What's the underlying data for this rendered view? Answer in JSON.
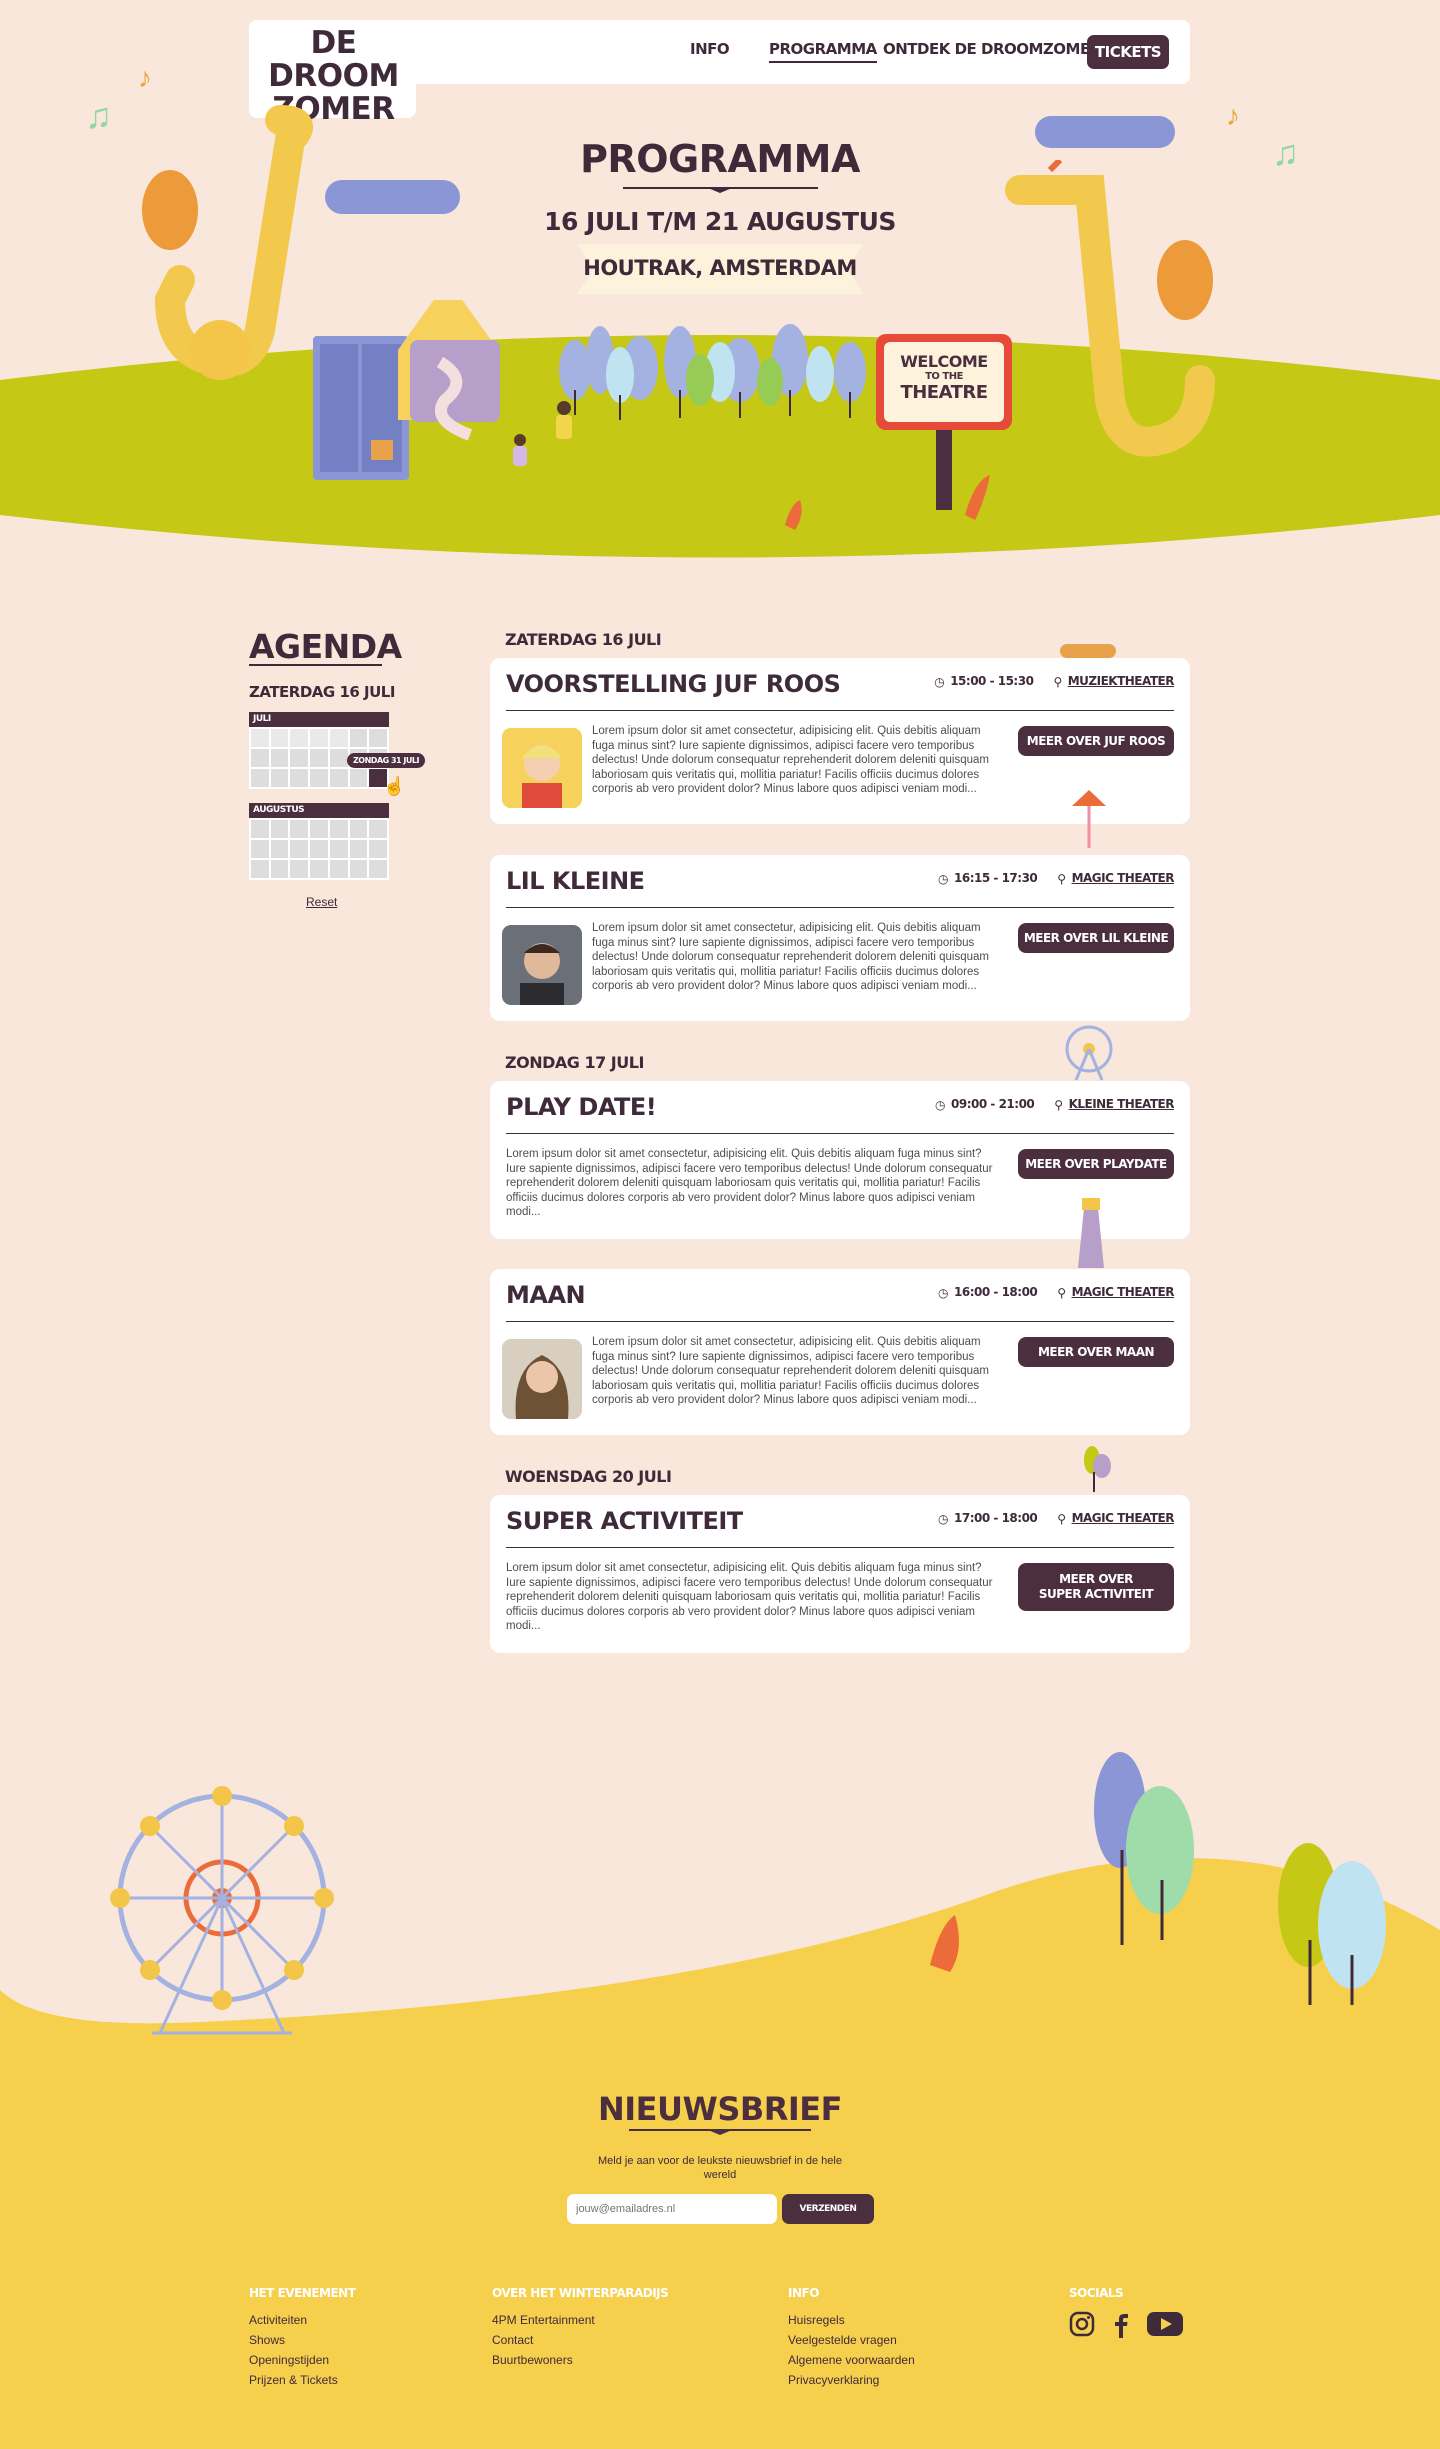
{
  "brand": {
    "logo_line1": "DE",
    "logo_line2": "DROOM",
    "logo_line3": "ZOMER"
  },
  "nav": {
    "items": [
      {
        "label": "INFO"
      },
      {
        "label": "PROGRAMMA"
      },
      {
        "label": "ONTDEK DE DROOMZOMER"
      }
    ],
    "tickets_label": "TICKETS"
  },
  "hero": {
    "title": "PROGRAMMA",
    "dates": "16 JULI T/M 21 AUGUSTUS",
    "location": "HOUTRAK, AMSTERDAM",
    "sign_line1": "WELCOME",
    "sign_line2": "TO THE",
    "sign_line3": "THEATRE"
  },
  "sidebar": {
    "title": "AGENDA",
    "selected_date": "ZATERDAG 16 JULI",
    "months": [
      {
        "name": "JULI"
      },
      {
        "name": "AUGUSTUS"
      }
    ],
    "tooltip": "ZONDAG 31 JULI",
    "reset_label": "Reset"
  },
  "days": [
    {
      "label": "ZATERDAG 16 JULI"
    },
    {
      "label": "ZONDAG 17 JULI"
    },
    {
      "label": "WOENSDAG 20 JULI"
    }
  ],
  "events": [
    {
      "title": "VOORSTELLING JUF ROOS",
      "time": "15:00 - 15:30",
      "venue": "MUZIEKTHEATER",
      "button": "MEER OVER JUF ROOS",
      "description": "Lorem ipsum dolor sit amet consectetur, adipisicing elit. Quis debitis aliquam fuga minus sint? Iure sapiente dignissimos, adipisci facere vero temporibus delectus! Unde dolorum consequatur reprehenderit dolorem deleniti quisquam laboriosam quis veritatis qui, mollitia pariatur! Facilis officiis ducimus dolores corporis ab vero provident dolor? Minus labore quos adipisci veniam modi..."
    },
    {
      "title": "LIL KLEINE",
      "time": "16:15 - 17:30",
      "venue": "MAGIC THEATER",
      "button": "MEER OVER LIL KLEINE",
      "description": "Lorem ipsum dolor sit amet consectetur, adipisicing elit. Quis debitis aliquam fuga minus sint? Iure sapiente dignissimos, adipisci facere vero temporibus delectus! Unde dolorum consequatur reprehenderit dolorem deleniti quisquam laboriosam quis veritatis qui, mollitia pariatur! Facilis officiis ducimus dolores corporis ab vero provident dolor? Minus labore quos adipisci veniam modi..."
    },
    {
      "title": "PLAY DATE!",
      "time": "09:00 - 21:00",
      "venue": "KLEINE THEATER",
      "button": "MEER OVER PLAYDATE",
      "description": "Lorem ipsum dolor sit amet consectetur, adipisicing elit. Quis debitis aliquam fuga minus sint? Iure sapiente dignissimos, adipisci facere vero temporibus delectus! Unde dolorum consequatur reprehenderit dolorem deleniti quisquam laboriosam quis veritatis qui, mollitia pariatur! Facilis officiis ducimus dolores corporis ab vero provident dolor? Minus labore quos adipisci veniam modi..."
    },
    {
      "title": "MAAN",
      "time": "16:00 - 18:00",
      "venue": "MAGIC THEATER",
      "button": "MEER OVER MAAN",
      "description": "Lorem ipsum dolor sit amet consectetur, adipisicing elit. Quis debitis aliquam fuga minus sint? Iure sapiente dignissimos, adipisci facere vero temporibus delectus! Unde dolorum consequatur reprehenderit dolorem deleniti quisquam laboriosam quis veritatis qui, mollitia pariatur! Facilis officiis ducimus dolores corporis ab vero provident dolor? Minus labore quos adipisci veniam modi..."
    },
    {
      "title": "SUPER ACTIVITEIT",
      "time": "17:00 - 18:00",
      "venue": "MAGIC THEATER",
      "button_line1": "MEER OVER",
      "button_line2": "SUPER ACTIVITEIT",
      "description": "Lorem ipsum dolor sit amet consectetur, adipisicing elit. Quis debitis aliquam fuga minus sint? Iure sapiente dignissimos, adipisci facere vero temporibus delectus! Unde dolorum consequatur reprehenderit dolorem deleniti quisquam laboriosam quis veritatis qui, mollitia pariatur! Facilis officiis ducimus dolores corporis ab vero provident dolor? Minus labore quos adipisci veniam modi..."
    }
  ],
  "newsletter": {
    "title": "NIEUWSBRIEF",
    "text": "Meld je aan voor de leukste nieuwsbrief in de hele wereld",
    "placeholder": "jouw@emailadres.nl",
    "button": "VERZENDEN"
  },
  "footer": {
    "col1": {
      "heading": "HET EVENEMENT",
      "links": [
        "Activiteiten",
        "Shows",
        "Openingstijden",
        "Prijzen & Tickets"
      ]
    },
    "col2": {
      "heading": "OVER HET WINTERPARADIJS",
      "links": [
        "4PM Entertainment",
        "Contact",
        "Buurtbewoners"
      ]
    },
    "col3": {
      "heading": "INFO",
      "links": [
        "Huisregels",
        "Veelgestelde vragen",
        "Algemene voorwaarden",
        "Privacyverklaring"
      ]
    },
    "col4": {
      "heading": "SOCIALS"
    }
  },
  "colors": {
    "dark": "#4c2f3f",
    "background": "#f8e7da",
    "grass": "#c5c814",
    "footer_yellow": "#f6cf4c"
  }
}
